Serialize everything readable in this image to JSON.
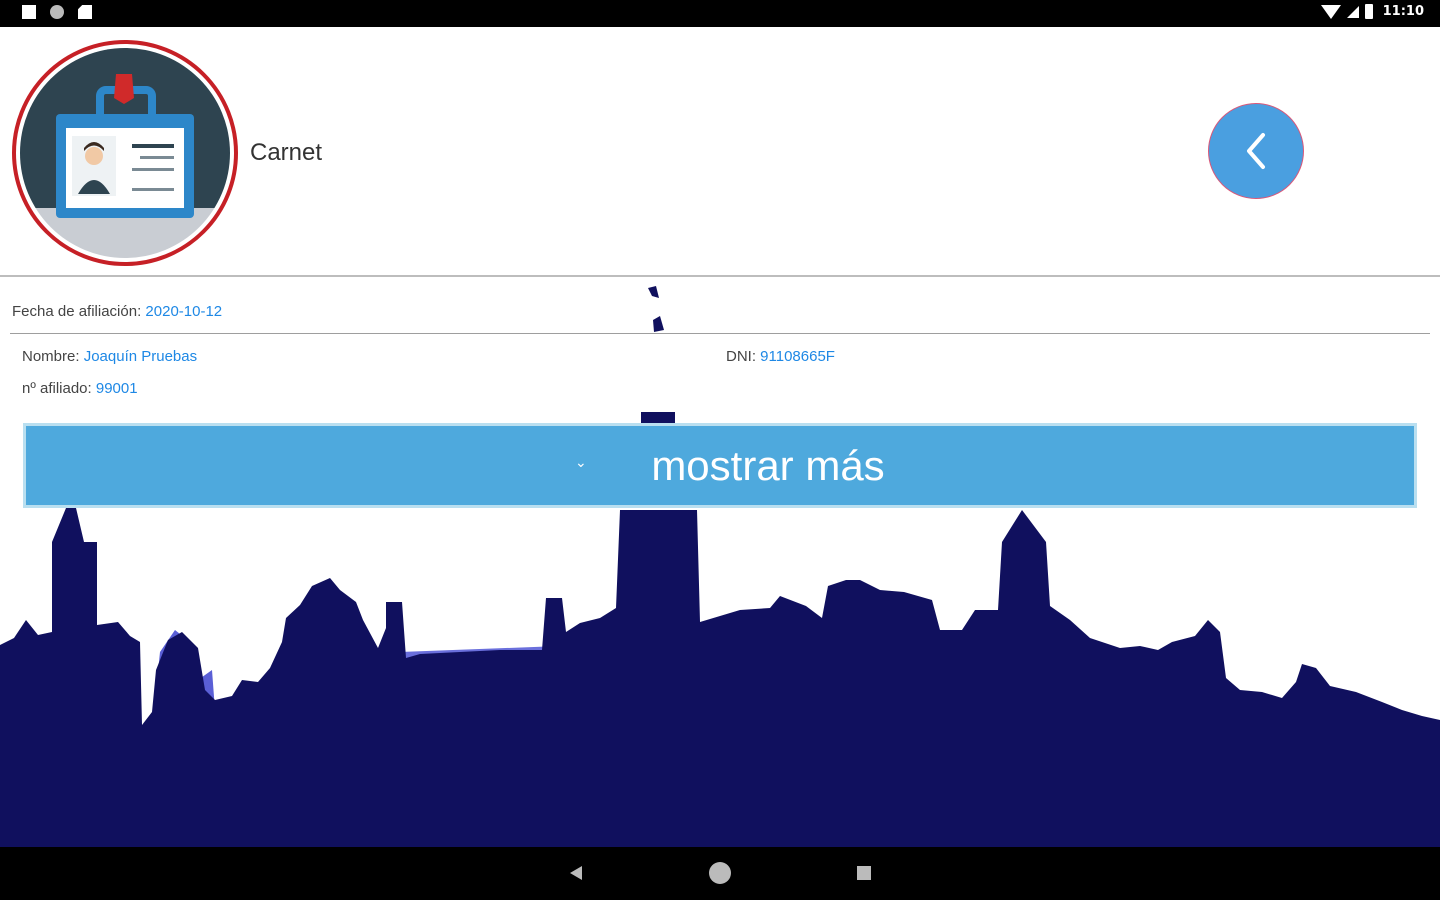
{
  "status_bar": {
    "time": "11:10",
    "icons": [
      "notification-icon",
      "circle-icon",
      "sd-card-icon",
      "wifi-icon",
      "signal-icon",
      "battery-icon"
    ]
  },
  "header": {
    "title": "Carnet",
    "avatar_icon": "id-card-icon",
    "back_icon": "chevron-left-icon"
  },
  "member": {
    "fecha_label": "Fecha de afiliación:",
    "fecha_value": "2020-10-12",
    "nombre_label": "Nombre:",
    "nombre_value": "Joaquín Pruebas",
    "dni_label": "DNI:",
    "dni_value": "91108665F",
    "afiliado_label": "nº afiliado:",
    "afiliado_value": "99001"
  },
  "expand": {
    "label": "mostrar más",
    "icon": "chevron-down-icon"
  },
  "colors": {
    "accent": "#4ea9dd",
    "value_text": "#1e88e5",
    "skyline": "#10105e",
    "avatar_border": "#c62026"
  },
  "nav_bar": {
    "icons": [
      "nav-back-icon",
      "nav-home-icon",
      "nav-recents-icon"
    ]
  }
}
